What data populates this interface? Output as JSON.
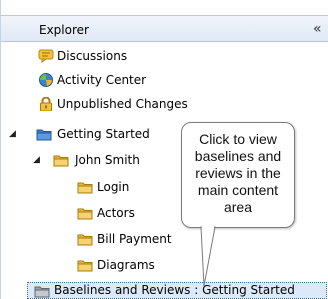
{
  "explorer": {
    "title": "Explorer",
    "collapse_glyph": "«",
    "items": [
      {
        "label": "Discussions",
        "icon": "discussion-icon"
      },
      {
        "label": "Activity Center",
        "icon": "activity-center-icon"
      },
      {
        "label": "Unpublished Changes",
        "icon": "lock-icon"
      }
    ],
    "tree": {
      "root": {
        "label": "Getting Started",
        "expanded": true
      },
      "child": {
        "label": "John Smith",
        "expanded": true
      },
      "folders": [
        "Login",
        "Actors",
        "Bill Payment",
        "Diagrams"
      ],
      "selected": "Baselines and Reviews : Getting Started"
    }
  },
  "tooltip": {
    "text": "Click to view baselines and reviews in the main content area"
  },
  "colors": {
    "header_bg": "#dfe8f5",
    "folder": "#f3c64d",
    "selected_bg": "#dce9f8"
  }
}
